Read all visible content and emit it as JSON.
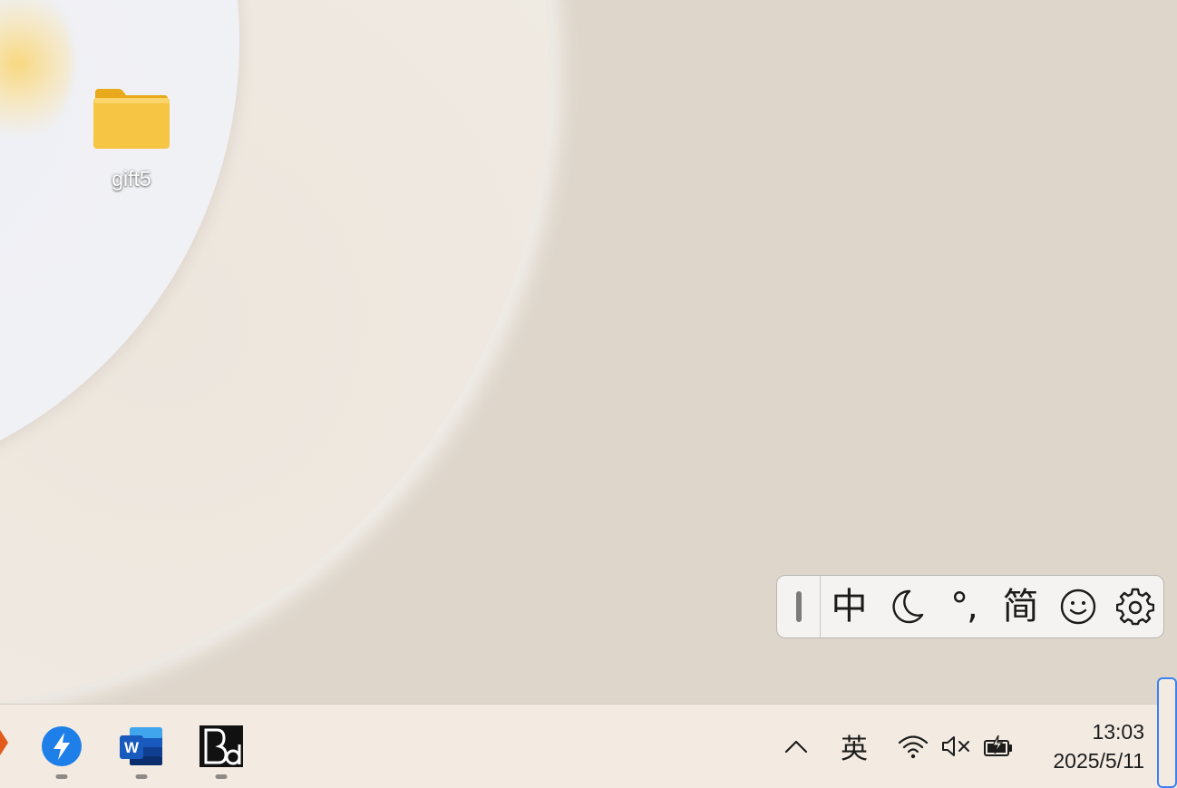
{
  "desktop": {
    "icons": [
      {
        "label": "gift5",
        "icon": "folder-icon"
      }
    ]
  },
  "ime_toolbar": {
    "mode_label": "中",
    "theme_icon": "moon-icon",
    "punctuation_label": "°,",
    "script_label": "简",
    "emoji_icon": "smiley-icon",
    "settings_icon": "gear-icon"
  },
  "taskbar": {
    "apps": [
      {
        "name": "Thunder",
        "icon": "thunder-lightning-icon",
        "running": true
      },
      {
        "name": "Word",
        "icon": "word-icon",
        "running": true
      },
      {
        "name": "Bd app",
        "icon": "bd-app-icon",
        "running": true
      }
    ],
    "tray": {
      "overflow_icon": "chevron-up-icon",
      "language_label": "英",
      "wifi_icon": "wifi-icon",
      "volume_icon": "volume-muted-icon",
      "battery_icon": "battery-charging-icon"
    },
    "clock": {
      "time": "13:03",
      "date": "2025/5/11"
    }
  },
  "colors": {
    "wallpaper": "#ded6cb",
    "taskbar": "#f3ebe2",
    "accent": "#3c82f0",
    "folder": "#f6c544",
    "thunder_blue": "#1e7fe8",
    "word_blue": "#185abd"
  }
}
